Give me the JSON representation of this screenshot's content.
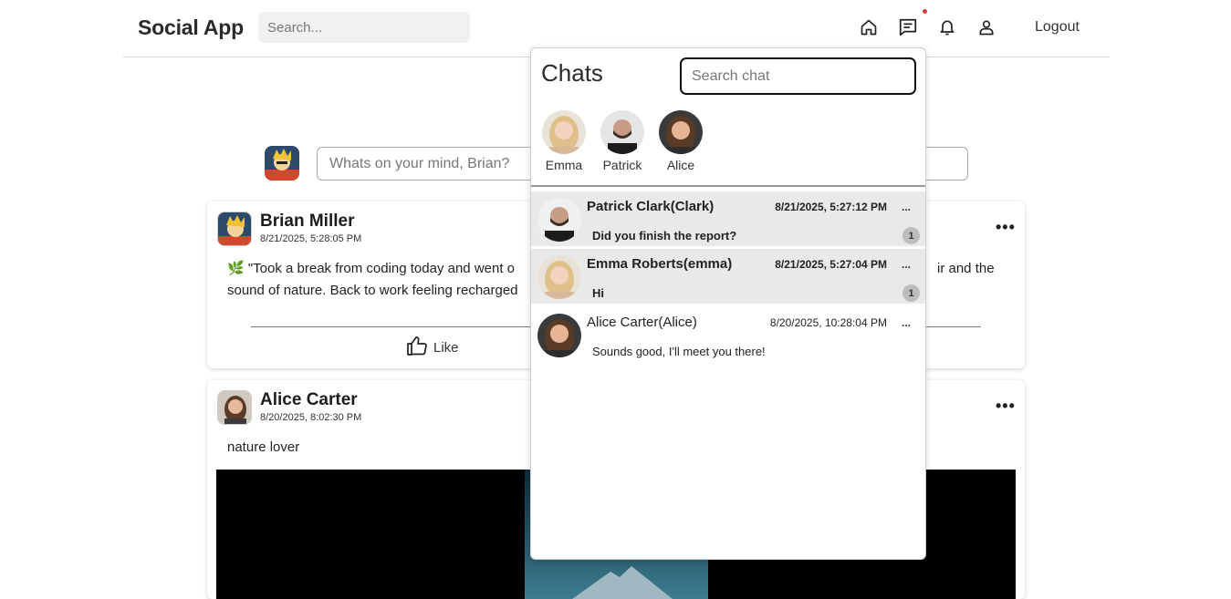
{
  "header": {
    "brand": "Social App",
    "search_placeholder": "Search...",
    "logout_label": "Logout"
  },
  "composer": {
    "placeholder": "Whats on your mind, Brian?"
  },
  "posts": [
    {
      "author": "Brian Miller",
      "time": "8/21/2025, 5:28:05 PM",
      "text_left": "🌿 \"Took a break from coding today and went o",
      "text_right": "ir and the",
      "text_line2": "sound of nature. Back to work feeling recharged",
      "like_label": "Like"
    },
    {
      "author": "Alice Carter",
      "time": "8/20/2025, 8:02:30 PM",
      "text": "nature lover"
    }
  ],
  "chat_panel": {
    "title": "Chats",
    "search_placeholder": "Search chat",
    "stories": [
      {
        "name": "Emma"
      },
      {
        "name": "Patrick"
      },
      {
        "name": "Alice"
      }
    ],
    "conversations": [
      {
        "name": "Patrick Clark(Clark)",
        "time": "8/21/2025, 5:27:12 PM",
        "message": "Did you finish the report?",
        "unread": "1",
        "more": "..."
      },
      {
        "name": "Emma Roberts(emma)",
        "time": "8/21/2025, 5:27:04 PM",
        "message": "Hi",
        "unread": "1",
        "more": "..."
      },
      {
        "name": "Alice Carter(Alice)",
        "time": "8/20/2025, 10:28:04 PM",
        "message": "Sounds good, I'll meet you there!",
        "more": "..."
      }
    ]
  },
  "colors": {
    "notification_dot": "#e23b3b",
    "unread_row_bg": "#e9e9e9",
    "badge_bg": "#bdbdbd"
  }
}
